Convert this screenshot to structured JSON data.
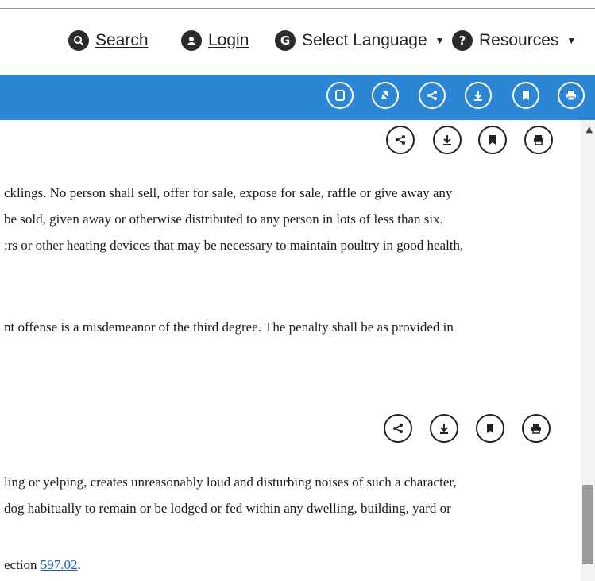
{
  "nav": {
    "search": "Search",
    "login": "Login",
    "language": "Select Language",
    "resources": "Resources"
  },
  "icons": {
    "search": "search-icon",
    "login": "user-icon",
    "language": "google-icon",
    "resources": "help-icon"
  },
  "toolbar_icons": [
    "doc-icon",
    "alert-off-icon",
    "share-icon",
    "download-icon",
    "bookmark-icon",
    "print-icon"
  ],
  "colors": {
    "accent": "#2b86d6"
  },
  "section1": {
    "lines": [
      "cklings.  No person shall sell, offer for sale, expose for sale, raffle or give away any",
      " be sold, given away or otherwise distributed to any person in lots of less than six.",
      ":rs or other heating devices that may be necessary to maintain poultry in good health,"
    ],
    "penalty": "nt offense is a misdemeanor of the third degree.  The penalty shall be as provided in"
  },
  "section2": {
    "lines": [
      "ling or yelping, creates unreasonably loud and disturbing noises of such a character,",
      " dog habitually to remain or be lodged or fed within any dwelling, building, yard or"
    ],
    "ref_prefix": "ection ",
    "ref_link": "597.02",
    "ref_suffix": "."
  }
}
